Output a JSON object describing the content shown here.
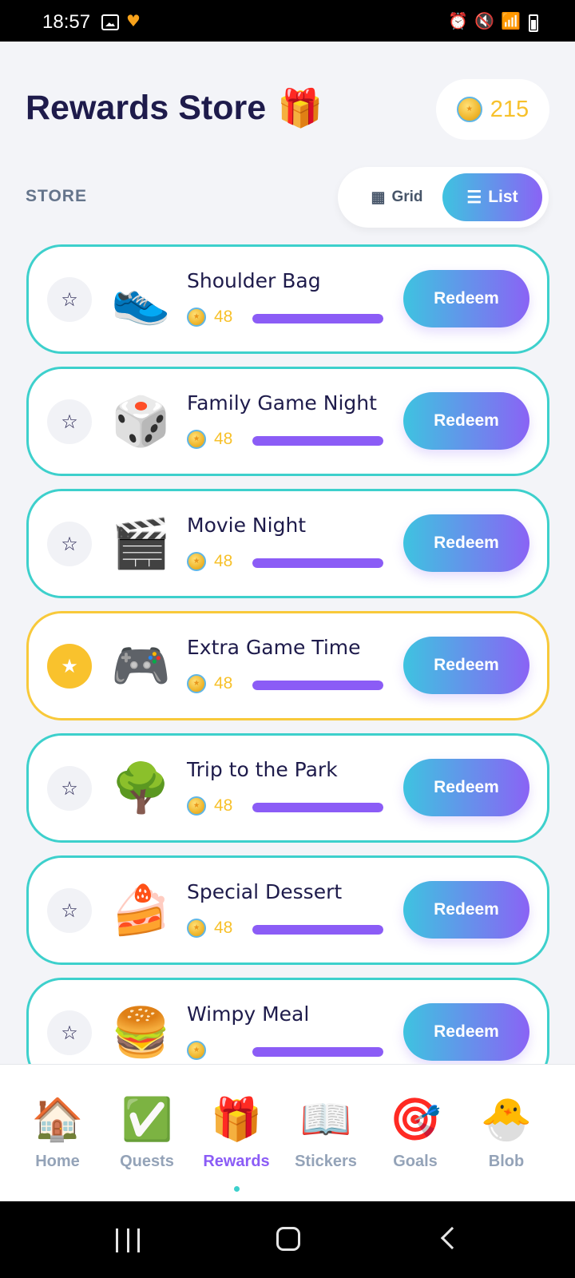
{
  "status_bar": {
    "time": "18:57",
    "icons": [
      "gallery-icon",
      "heart-app-icon",
      "alarm-icon",
      "mute-icon",
      "wifi-icon",
      "signal-icon",
      "battery-icon"
    ]
  },
  "header": {
    "title": "Rewards Store",
    "title_emoji": "🎁",
    "coin_balance": "215"
  },
  "store": {
    "label": "STORE",
    "view_toggle": {
      "grid_label": "Grid",
      "list_label": "List",
      "selected": "List"
    }
  },
  "rewards": [
    {
      "name": "Shoulder Bag",
      "emoji": "👟",
      "cost": "48",
      "favorite": false,
      "progress": 1.0,
      "redeem_label": "Redeem"
    },
    {
      "name": "Family Game Night",
      "emoji": "🎲",
      "cost": "48",
      "favorite": false,
      "progress": 1.0,
      "redeem_label": "Redeem"
    },
    {
      "name": "Movie Night",
      "emoji": "🎬",
      "cost": "48",
      "favorite": false,
      "progress": 1.0,
      "redeem_label": "Redeem"
    },
    {
      "name": "Extra Game Time",
      "emoji": "🎮",
      "cost": "48",
      "favorite": true,
      "progress": 1.0,
      "redeem_label": "Redeem"
    },
    {
      "name": "Trip to the Park",
      "emoji": "🌳",
      "cost": "48",
      "favorite": false,
      "progress": 1.0,
      "redeem_label": "Redeem"
    },
    {
      "name": "Special Dessert",
      "emoji": "🍰",
      "cost": "48",
      "favorite": false,
      "progress": 1.0,
      "redeem_label": "Redeem"
    },
    {
      "name": "Wimpy Meal",
      "emoji": "🍔",
      "cost": "",
      "favorite": false,
      "progress": 1.0,
      "redeem_label": "Redeem"
    }
  ],
  "bottom_nav": [
    {
      "label": "Home",
      "emoji": "🏠",
      "active": false
    },
    {
      "label": "Quests",
      "emoji": "✅",
      "active": false
    },
    {
      "label": "Rewards",
      "emoji": "🎁",
      "active": true
    },
    {
      "label": "Stickers",
      "emoji": "📖",
      "active": false
    },
    {
      "label": "Goals",
      "emoji": "🎯",
      "active": false
    },
    {
      "label": "Blob",
      "emoji": "🐣",
      "active": false
    }
  ],
  "colors": {
    "accent_teal": "#3dd0cc",
    "accent_purple": "#8b5cf6",
    "favorite_gold": "#f9c22d",
    "coin_text": "#f7c12b",
    "title": "#1e1b4b"
  }
}
